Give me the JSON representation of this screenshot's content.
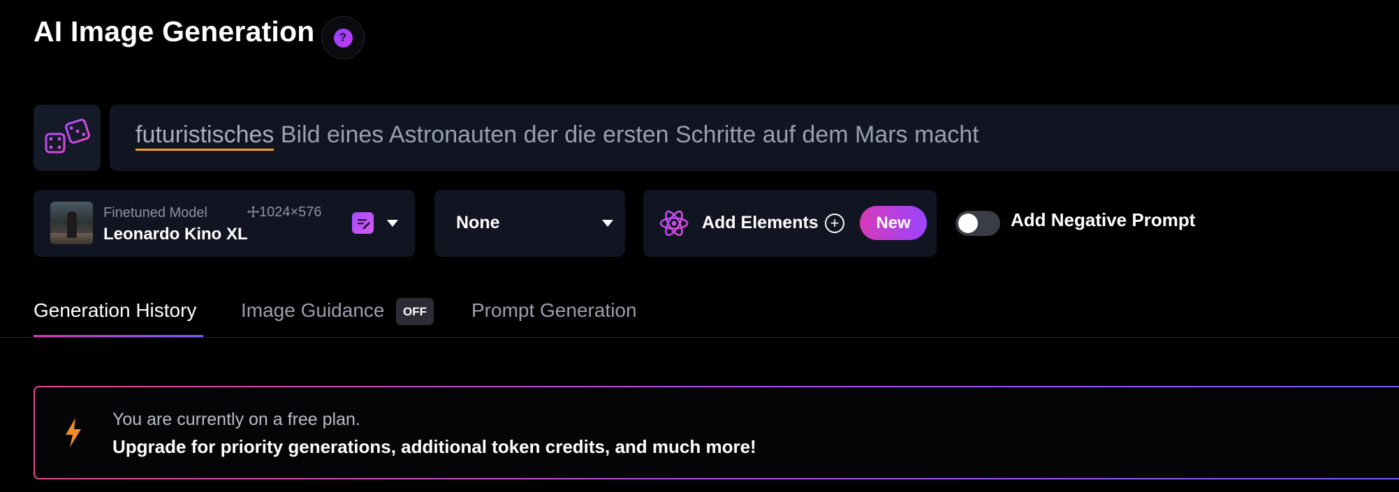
{
  "header": {
    "title": "AI Image Generation",
    "help_label": "?"
  },
  "prompt": {
    "first_word": "futuristisches",
    "rest": " Bild eines Astronauten der die ersten Schritte auf dem Mars macht"
  },
  "model": {
    "subtitle": "Finetuned Model",
    "resolution": "1024×576",
    "name": "Leonardo Kino XL"
  },
  "style": {
    "selected": "None"
  },
  "elements": {
    "label": "Add Elements",
    "plus": "+",
    "badge": "New"
  },
  "negative_prompt": {
    "label": "Add Negative Prompt",
    "enabled": false
  },
  "tabs": [
    {
      "label": "Generation History",
      "active": true
    },
    {
      "label": "Image Guidance",
      "badge": "OFF"
    },
    {
      "label": "Prompt Generation"
    }
  ],
  "banner": {
    "line1": "You are currently on a free plan.",
    "line2": "Upgrade for priority generations, additional token credits, and much more!"
  },
  "colors": {
    "accent_purple": "#9a45ff",
    "accent_pink": "#d63ab8",
    "underline_orange": "#f2a21b",
    "bolt_orange": "#f28c28"
  },
  "icons": [
    "help-icon",
    "dice-icon",
    "move-icon",
    "edit-icon",
    "chevron-down-icon",
    "atom-icon",
    "plus-circle-icon",
    "bolt-icon"
  ]
}
